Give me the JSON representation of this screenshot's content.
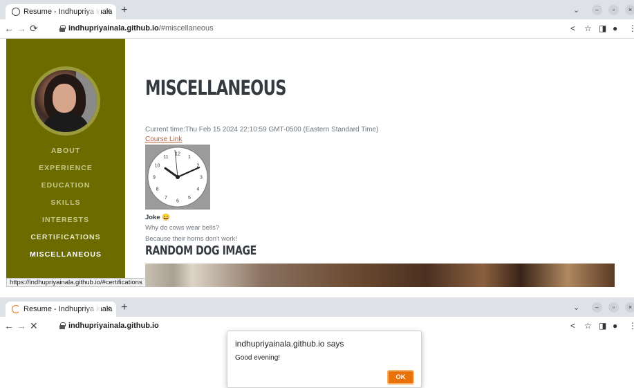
{
  "window1": {
    "tab_title": "Resume - Indhupriya inala",
    "tab_close": "×",
    "new_tab": "+",
    "url_host": "indhupriyainala.github.io",
    "url_path": "/#miscellaneous",
    "status_url": "https://indhupriyainala.github.io/#certifications"
  },
  "window2": {
    "tab_title": "Resume - Indhupriya inala",
    "tab_close": "×",
    "new_tab": "+",
    "url_host": "indhupriyainala.github.io",
    "url_path": "",
    "dialog": {
      "title": "indhupriyainala.github.io says",
      "message": "Good evening!",
      "ok_label": "OK"
    }
  },
  "sidebar": {
    "items": [
      {
        "label": "ABOUT",
        "active": false
      },
      {
        "label": "EXPERIENCE",
        "active": false
      },
      {
        "label": "EDUCATION",
        "active": false
      },
      {
        "label": "SKILLS",
        "active": false
      },
      {
        "label": "INTERESTS",
        "active": false
      },
      {
        "label": "CERTIFICATIONS",
        "active": false
      },
      {
        "label": "MISCELLANEOUS",
        "active": true
      }
    ]
  },
  "main": {
    "title": "MISCELLANEOUS",
    "current_time": "Current time:Thu Feb 15 2024 22:10:59 GMT-0500 (Eastern Standard Time)",
    "course_link": "Course Link",
    "clock": {
      "numbers": [
        "12",
        "1",
        "2",
        "3",
        "4",
        "5",
        "6",
        "7",
        "8",
        "9",
        "10",
        "11"
      ],
      "hour": 10,
      "minute": 11
    },
    "joke_title": "Joke 😄",
    "joke_q": "Why do cows wear bells?",
    "joke_a": "Because their horns don't work!",
    "dog_heading": "RANDOM DOG IMAGE"
  },
  "colors": {
    "sidebar": "#6b6b00",
    "accent": "#bd5d38",
    "ok_button": "#e8710a"
  },
  "icons": [
    "back-arrow-icon",
    "forward-arrow-icon",
    "reload-icon",
    "stop-icon",
    "lock-icon",
    "share-icon",
    "star-icon",
    "sidebar-icon",
    "profile-icon",
    "menu-dots-icon"
  ]
}
